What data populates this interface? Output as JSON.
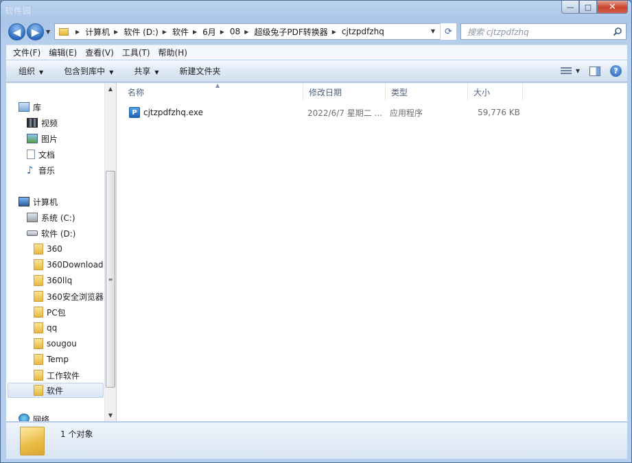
{
  "window": {
    "title_blur": "软件园",
    "controls": {
      "minimize": "—",
      "maximize": "□",
      "close": "✕"
    }
  },
  "nav": {
    "back_icon": "◀",
    "forward_icon": "▶"
  },
  "address": {
    "crumbs": [
      "计算机",
      "软件 (D:)",
      "软件",
      "6月",
      "08",
      "超级兔子PDF转换器",
      "cjtzpdfzhq"
    ]
  },
  "search": {
    "placeholder": "搜索 cjtzpdfzhq"
  },
  "menubar": [
    "文件(F)",
    "编辑(E)",
    "查看(V)",
    "工具(T)",
    "帮助(H)"
  ],
  "commandbar": {
    "organize": "组织",
    "include_library": "包含到库中",
    "share": "共享",
    "new_folder": "新建文件夹"
  },
  "sidebar": {
    "libraries": {
      "label": "库",
      "items": [
        "视频",
        "图片",
        "文档",
        "音乐"
      ]
    },
    "computer": {
      "label": "计算机",
      "drives": [
        "系统 (C:)",
        "软件 (D:)"
      ]
    },
    "folders": [
      "360",
      "360Download",
      "360llq",
      "360安全浏览器",
      "PC包",
      "qq",
      "sougou",
      "Temp",
      "工作软件",
      "软件"
    ],
    "selected_folder": "软件",
    "network": "网络"
  },
  "columns": {
    "name": "名称",
    "modified": "修改日期",
    "type": "类型",
    "size": "大小"
  },
  "files": [
    {
      "name": "cjtzpdfzhq.exe",
      "modified": "2022/6/7 星期二 ...",
      "type": "应用程序",
      "size": "59,776 KB"
    }
  ],
  "status": {
    "text": "1 个对象"
  }
}
